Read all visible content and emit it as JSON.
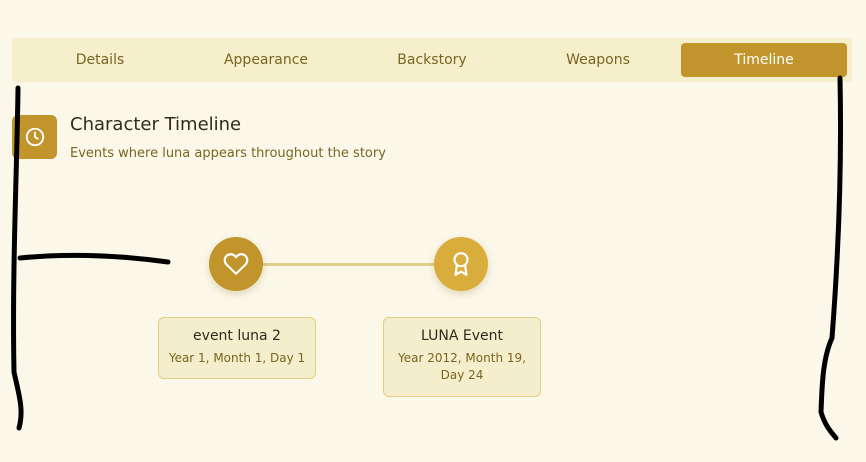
{
  "tabs": [
    {
      "label": "Details"
    },
    {
      "label": "Appearance"
    },
    {
      "label": "Backstory"
    },
    {
      "label": "Weapons"
    },
    {
      "label": "Timeline",
      "active": true
    }
  ],
  "header": {
    "icon": "clock-icon",
    "title": "Character Timeline",
    "subtitle": "Events where luna appears throughout the story"
  },
  "timeline": {
    "events": [
      {
        "icon": "heart-icon",
        "title": "event luna 2",
        "date": "Year 1, Month 1, Day 1"
      },
      {
        "icon": "award-icon",
        "title": "LUNA Event",
        "date": "Year 2012, Month 19, Day 24"
      }
    ]
  },
  "colors": {
    "accent": "#c1952c",
    "accent_light": "#d8ad3c",
    "background": "#fbf8ea",
    "tab_bar": "#f5efcc",
    "card_bg": "#f5eecc",
    "connector": "#e0cd8c",
    "text_muted": "#7a6520",
    "text_dark": "#2f2a1c"
  }
}
